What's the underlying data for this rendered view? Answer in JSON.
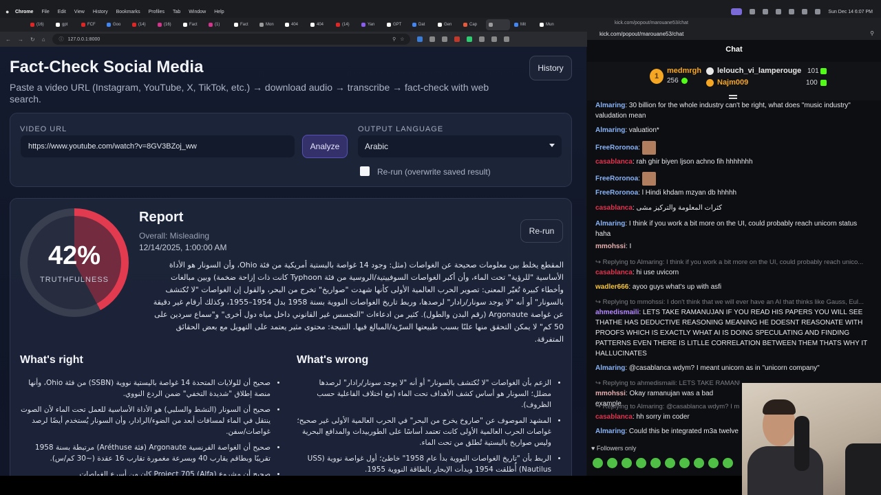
{
  "menubar": {
    "items": [
      "Chrome",
      "File",
      "Edit",
      "View",
      "History",
      "Bookmarks",
      "Profiles",
      "Tab",
      "Window",
      "Help"
    ],
    "clock": "Sun Dec 14  6:07 PM"
  },
  "tabs": [
    {
      "label": "(16)",
      "color": "#e02525"
    },
    {
      "label": "gpt",
      "color": "#ffffff"
    },
    {
      "label": "FCF",
      "color": "#e02525"
    },
    {
      "label": "Goo",
      "color": "#4285f4"
    },
    {
      "label": "(14)",
      "color": "#e02525"
    },
    {
      "label": "(16)",
      "color": "#d6338d"
    },
    {
      "label": "Fact",
      "color": "#ffffff"
    },
    {
      "label": "(1)",
      "color": "#d6338d"
    },
    {
      "label": "Fact",
      "color": "#ffffff"
    },
    {
      "label": "Mon",
      "color": "#9b9b9b"
    },
    {
      "label": "404",
      "color": "#ffffff"
    },
    {
      "label": "404",
      "color": "#ffffff"
    },
    {
      "label": "(14)",
      "color": "#e02525"
    },
    {
      "label": "Yan",
      "color": "#8b5cf6"
    },
    {
      "label": "GPT",
      "color": "#ffffff"
    },
    {
      "label": "Dat",
      "color": "#4285f4"
    },
    {
      "label": "Gen",
      "color": "#ffffff"
    },
    {
      "label": "Cap",
      "color": "#e8583a"
    },
    {
      "label": "",
      "color": "#9b9b9b"
    },
    {
      "label": "Mit",
      "color": "#4285f4"
    },
    {
      "label": "Mun",
      "color": "#ffffff"
    }
  ],
  "browser": {
    "url": "127.0.0.1:8000"
  },
  "page": {
    "title": "Fact-Check Social Media",
    "subtitle": "Paste a video URL (Instagram, YouTube, X, TikTok, etc.) → download audio → transcribe → fact-check with web search.",
    "history_label": "History"
  },
  "form": {
    "url_label": "VIDEO URL",
    "url_value": "https://www.youtube.com/watch?v=8GV3BZoj_ww",
    "analyze_label": "Analyze",
    "lang_label": "OUTPUT LANGUAGE",
    "lang_value": "Arabic",
    "rerun_checkbox_label": "Re-run (overwrite saved result)"
  },
  "report": {
    "truthfulness": 0.42,
    "percent_text": "42%",
    "truth_label": "TRUTHFULNESS",
    "title": "Report",
    "overall": "Overall: Misleading",
    "date": "12/14/2025, 1:00:00 AM",
    "rerun_label": "Re-run",
    "summary": "المقطع يخلط بين معلومات صحيحة عن الغواصات (مثل: وجود 14 غواصة باليستية أمريكية من فئة Ohio، وأن السونار هو الأداة الأساسية \"للرؤية\" تحت الماء، وأن أكبر الغواصات السوفييتية/الروسية من فئة Typhoon كانت ذات إزاحة ضخمة) وبين مبالغات وأخطاء كبيرة تُغيّر المعنى: تصوير الحرب العالمية الأولى كأنها شهدت \"صواريخ\" تخرج من البحر، والقول إن الغواصات \"لا تُكتشف بالسونار\" أو أنه \"لا يوجد سونار/رادار\" لرصدها، وربط تاريخ الغواصات النووية بسنة 1958 بدل 1954–1955، وكذلك أرقام غير دقيقة عن غواصة Argonaute (رقم البدن والطول). كثير من ادعاءات \"التجسس غير القانوني داخل مياه دول أخرى\" و\"سماع سردين على 50 كم\" لا يمكن التحقق منها علنًا بسبب طبيعتها السرّية/المبالغ فيها. النتيجة: محتوى مثير يعتمد على التهويل مع بعض الحقائق المتفرقة.",
    "right_title": "What's right",
    "right_items": [
      "صحيح أن للولايات المتحدة 14 غواصة باليستية نووية (SSBN) من فئة Ohio، وأنها منصة إطلاق \"شديدة التخفي\" ضمن الردع النووي.",
      "صحيح أن السونار (النشط والسلبي) هو الأداة الأساسية للعمل تحت الماء لأن الصوت ينتقل في الماء لمسافات أبعد من الضوء/الرادار، وأن السونار يُستخدم أيضًا لرصد غواصات/سفن.",
      "صحيح أن الغواصة الفرنسية Argonaute (فئة Aréthuse) مرتبطة بسنة 1958 تقريبًا وبطاقم يقارب 40 وبسرعة مغمورة تقارب 16 عقدة (~30 كم/س).",
      "صحيح أن مشروع Project 705 (Alfa) كان من أسرع الغواصات"
    ],
    "wrong_title": "What's wrong",
    "wrong_items": [
      "الزعم بأن الغواصات \"لا تُكتشف بالسونار\" أو أنه \"لا يوجد سونار/رادار\" لرصدها مضلل؛ السونار هو أساس كشف الأهداف تحت الماء (مع اختلاف الفاعلية حسب الظروف).",
      "المشهد الموصوف عن \"صاروخ يخرج من البحر\" في الحرب العالمية الأولى غير صحيح؛ غواصات الحرب العالمية الأولى كانت تعتمد أساسًا على الطوربيدات والمدافع البحرية وليس صواريخ باليستية تُطلق من تحت الماء.",
      "الربط بأن \"تاريخ الغواصات النووية بدأ عام 1958\" خاطئ؛ أول غواصة نووية (USS Nautilus) أُطلقت 1954 وبدأت الإبحار بالطاقة النووية 1955."
    ]
  },
  "chat": {
    "url_top": "kick.com/popout/marouane53/chat",
    "url": "kick.com/popout/marouane53/chat",
    "title": "Chat",
    "leaderboard": [
      {
        "rank": "1",
        "name": "medmrgh",
        "amount": "256",
        "color": "#f5a623"
      },
      {
        "rank": "2",
        "name": "lelouch_vi_lamperouge",
        "amount": "101",
        "color": "#e8e8e8"
      },
      {
        "rank": "3",
        "name": "Najm009",
        "amount": "100",
        "color": "#f5a623"
      }
    ],
    "messages": [
      {
        "user": "Almaring",
        "color": "#8ab4f8",
        "text": ": 30 billion for the whole industry can't be right, what does \"music industry\" valudation mean"
      },
      {
        "user": "Almaring",
        "color": "#8ab4f8",
        "text": ": valuation*"
      },
      {
        "user": "FreeRoronoa",
        "color": "#8ab4f8",
        "text": ":"
      },
      {
        "user": "casablanca",
        "color": "#e0344f",
        "text": ": rah ghir biyen ljson achno fih hhhhhhh"
      },
      {
        "user": "FreeRoronoa",
        "color": "#8ab4f8",
        "text": ":"
      },
      {
        "user": "FreeRoronoa",
        "color": "#8ab4f8",
        "text": ": l Hindi khdam mzyan db hhhhh"
      },
      {
        "user": "casablanca",
        "color": "#e0344f",
        "text": ": كثرات المعلومة والتركيز مشى"
      },
      {
        "user": "Almaring",
        "color": "#8ab4f8",
        "text": ": I think if you work a bit more on the UI, could probably reach unicorn status haha"
      },
      {
        "user": "mmohssi",
        "color": "#e8b0b0",
        "text": ": I"
      },
      {
        "reply": "Replying to Almaring: I think if you work a bit more on the UI, could probably reach unico...",
        "user": "casablanca",
        "color": "#e0344f",
        "text": ": hi use uvicorn"
      },
      {
        "user": "wadler666",
        "color": "#f5c542",
        "text": ": ayoo guys what's up with asfi"
      },
      {
        "reply": "Replying to mmohssi: I don't think that we will ever have an AI that thinks like Gauss, Eul...",
        "user": "ahmedismaili",
        "color": "#b488ff",
        "text": ": LETS TAKE RAMANUJAN IF YOU READ HIS PAPERS YOU WILL SEE THATHE HAS DEDUCTIVE REASONING MEANING HE DOESNT REASONATE WITH PROOFS WHICH IS EXACTLY WHAT AI IS DOING SPECULATING AND FINDING PATTERNS EVEN THERE IS LITLLE CORRELATION BETWEEN THEM THATS WHY IT HALLUCINATES"
      },
      {
        "user": "Almaring",
        "color": "#8ab4f8",
        "text": ": @casablanca wdym? I meant unicorn as in \"unicorn company\""
      },
      {
        "reply": "Replying to ahmedismaili: LETS TAKE RAMANUJAN IF YOU READ HIS PAPERS YOU WILL...",
        "user": "mmohssi",
        "color": "#e8b0b0",
        "text": ": Okay ramanujan was a bad example"
      },
      {
        "reply": "Replying to Almaring: @casablanca wdym? I m",
        "user": "casablanca",
        "color": "#e0344f",
        "text": ": hh sorry im coder"
      },
      {
        "user": "Almaring",
        "color": "#8ab4f8",
        "text": ": Could this be integrated m3a twelve"
      }
    ],
    "followers_only": "Followers only"
  }
}
